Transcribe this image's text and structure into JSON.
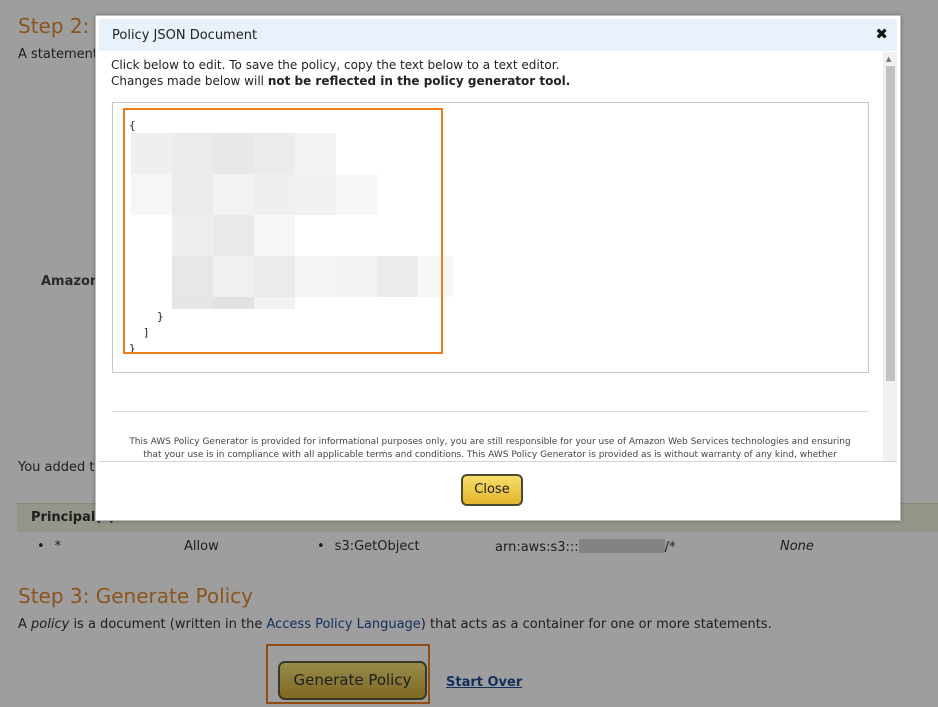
{
  "page": {
    "step2_heading": "Step 2:",
    "step2_text": "A statement",
    "amazon_label": "Amazon",
    "added_text": "You added t",
    "principal_header": "Principal(s)",
    "row": {
      "principal": "*",
      "effect": "Allow",
      "action": "s3:GetObject",
      "resource_prefix": "arn:aws:s3:::",
      "resource_suffix": "/*",
      "conditions": "None"
    },
    "step3_heading": "Step 3: Generate Policy",
    "policy_desc_a": "A ",
    "policy_desc_word": "policy",
    "policy_desc_b": " is a document (written in the ",
    "policy_desc_link": "Access Policy Language",
    "policy_desc_c": ") that acts as a container for one or more statements.",
    "generate_button": "Generate Policy",
    "start_over": "Start Over"
  },
  "modal": {
    "title": "Policy JSON Document",
    "close_glyph": "✖",
    "instruction_line1": "Click below to edit. To save the policy, copy the text below to a text editor.",
    "instruction_line2_a": "Changes made below will ",
    "instruction_line2_b": "not be reflected in the policy generator tool.",
    "json_lines": [
      "{",
      "}",
      "]",
      "}"
    ],
    "disclaimer": "This AWS Policy Generator is provided for informational purposes only, you are still responsible for your use of Amazon Web Services technologies and ensuring that your use is in compliance with all applicable terms and conditions. This AWS Policy Generator is provided as is without warranty of any kind, whether",
    "close_button": "Close",
    "scroll_up": "▲",
    "scroll_down": "▼"
  },
  "colors": {
    "accent_orange": "#ef7c1c",
    "heading_orange": "#e08a33",
    "link_blue": "#1f4e96",
    "button_gold": "#e3b52c"
  }
}
